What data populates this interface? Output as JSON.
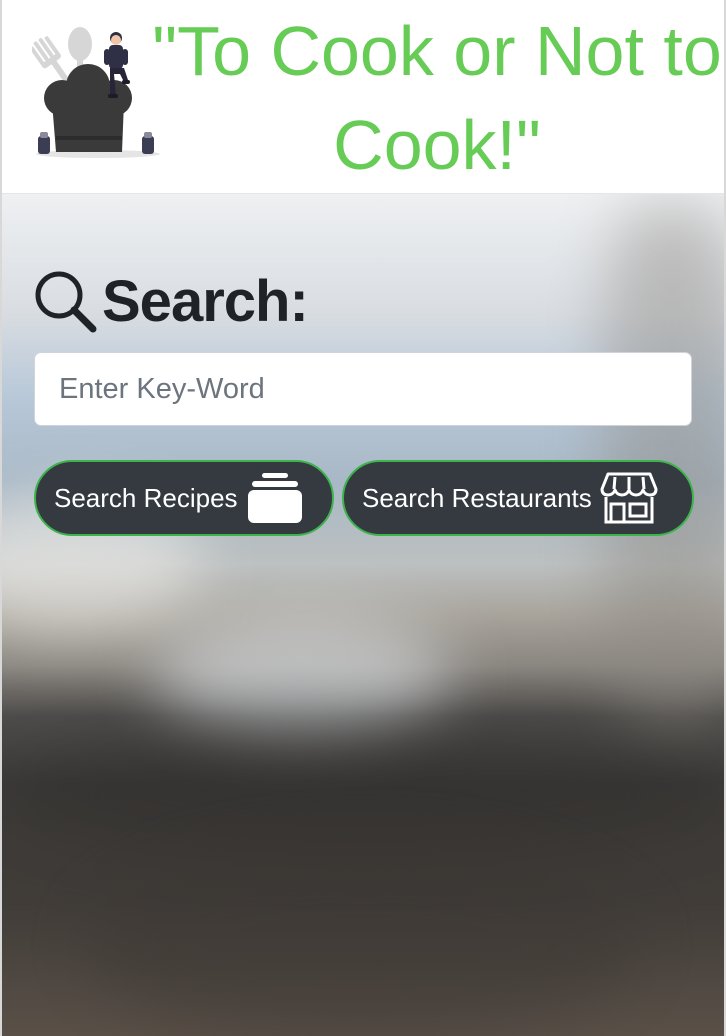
{
  "header": {
    "title": "\"To Cook or Not to Cook!\"",
    "logo_icon": "chef-hat-logo-icon"
  },
  "search": {
    "heading": "Search:",
    "heading_icon": "magnifier-icon",
    "input_value": "",
    "placeholder": "Enter Key-Word",
    "recipes_button": "Search Recipes",
    "recipes_icon": "cooking-pot-icon",
    "restaurants_button": "Search Restaurants",
    "restaurants_icon": "storefront-icon"
  },
  "colors": {
    "title_green": "#66cc55",
    "button_bg": "#343a40",
    "button_border": "#3cb44b",
    "heading_text": "#1f2327"
  }
}
